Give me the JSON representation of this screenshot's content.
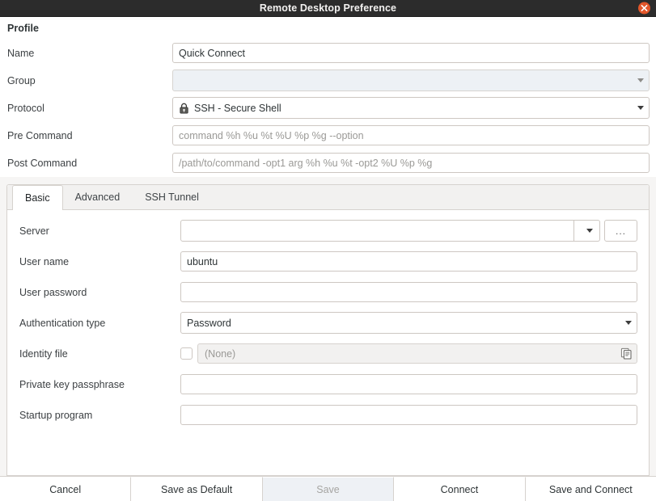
{
  "window": {
    "title": "Remote Desktop Preference",
    "close_icon": "close-icon"
  },
  "profile": {
    "section_title": "Profile",
    "rows": {
      "name": {
        "label": "Name",
        "value": "Quick Connect"
      },
      "group": {
        "label": "Group",
        "value": "",
        "icon": "chevron-down-icon"
      },
      "protocol": {
        "label": "Protocol",
        "value": "SSH - Secure Shell",
        "icon": "lock-icon",
        "arrow_icon": "chevron-down-icon"
      },
      "pre_command": {
        "label": "Pre Command",
        "value": "",
        "placeholder": "command %h %u %t %U %p %g --option"
      },
      "post_command": {
        "label": "Post Command",
        "value": "",
        "placeholder": "/path/to/command -opt1 arg %h %u %t -opt2 %U %p %g"
      }
    }
  },
  "tabs": [
    {
      "label": "Basic",
      "active": true
    },
    {
      "label": "Advanced",
      "active": false
    },
    {
      "label": "SSH Tunnel",
      "active": false
    }
  ],
  "basic_tab": {
    "server": {
      "label": "Server",
      "value": "",
      "arrow_icon": "chevron-down-icon",
      "browse_label": "...",
      "browse_icon": "ellipsis-icon"
    },
    "user_name": {
      "label": "User name",
      "value": "ubuntu"
    },
    "user_password": {
      "label": "User password",
      "value": ""
    },
    "authentication_type": {
      "label": "Authentication type",
      "value": "Password",
      "arrow_icon": "chevron-down-icon"
    },
    "identity_file": {
      "label": "Identity file",
      "value": "(None)",
      "checked": false,
      "checkbox_icon": "checkbox-unchecked-icon",
      "file_icon": "file-chooser-icon"
    },
    "private_key_passphrase": {
      "label": "Private key passphrase",
      "value": ""
    },
    "startup_program": {
      "label": "Startup program",
      "value": ""
    }
  },
  "buttons": [
    {
      "label": "Cancel",
      "disabled": false
    },
    {
      "label": "Save as Default",
      "disabled": false
    },
    {
      "label": "Save",
      "disabled": true
    },
    {
      "label": "Connect",
      "disabled": false
    },
    {
      "label": "Save and Connect",
      "disabled": false
    }
  ],
  "colors": {
    "titlebar_bg": "#2c2c2c",
    "close_button": "#e2562a",
    "window_bg": "#f6f5f4",
    "field_border": "#cdc7c2",
    "disabled_bg": "#eef1f5"
  }
}
